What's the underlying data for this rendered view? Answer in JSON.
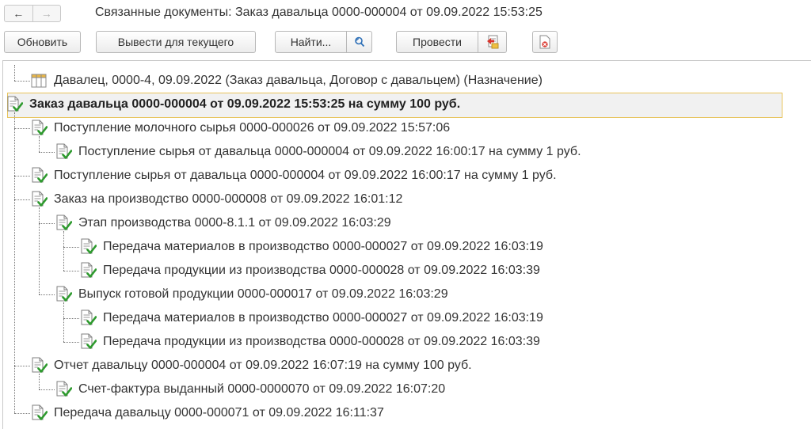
{
  "window": {
    "title": "Связанные документы: Заказ давальца 0000-000004 от 09.09.2022 15:53:25",
    "back_glyph": "←",
    "forward_glyph": "→"
  },
  "toolbar": {
    "refresh": "Обновить",
    "output_current": "Вывести для текущего",
    "find": "Найти...",
    "post": "Провести",
    "icons": {
      "find_refresh": "search-refresh-icon",
      "post_document": "post-document-icon",
      "delete_mark": "delete-mark-icon"
    }
  },
  "tree": {
    "rows": [
      {
        "label": "Давалец, 0000-4, 09.09.2022 (Заказ давальца, Договор с давальцем) (Назначение)",
        "level": 1,
        "icon": "register-table-icon"
      },
      {
        "label": "Заказ давальца 0000-000004 от 09.09.2022 15:53:25 на сумму 100 руб.",
        "level": 0,
        "icon": "posted-document-icon",
        "selected": true
      },
      {
        "label": "Поступление молочного сырья 0000-000026 от 09.09.2022 15:57:06",
        "level": 1,
        "icon": "posted-document-icon"
      },
      {
        "label": "Поступление сырья от давальца 0000-000004 от 09.09.2022 16:00:17 на сумму 1 руб.",
        "level": 2,
        "icon": "posted-document-icon"
      },
      {
        "label": "Поступление сырья от давальца 0000-000004 от 09.09.2022 16:00:17 на сумму 1 руб.",
        "level": 1,
        "icon": "posted-document-icon"
      },
      {
        "label": "Заказ на производство 0000-000008 от 09.09.2022 16:01:12",
        "level": 1,
        "icon": "posted-document-icon"
      },
      {
        "label": "Этап производства 0000-8.1.1 от 09.09.2022 16:03:29",
        "level": 2,
        "icon": "posted-document-icon"
      },
      {
        "label": "Передача материалов в производство 0000-000027 от 09.09.2022 16:03:19",
        "level": 3,
        "icon": "posted-document-icon"
      },
      {
        "label": "Передача продукции из производства 0000-000028 от 09.09.2022 16:03:39",
        "level": 3,
        "icon": "posted-document-icon"
      },
      {
        "label": "Выпуск готовой продукции 0000-000017 от 09.09.2022 16:03:29",
        "level": 2,
        "icon": "posted-document-icon"
      },
      {
        "label": "Передача материалов в производство 0000-000027 от 09.09.2022 16:03:19",
        "level": 3,
        "icon": "posted-document-icon"
      },
      {
        "label": "Передача продукции из производства 0000-000028 от 09.09.2022 16:03:39",
        "level": 3,
        "icon": "posted-document-icon"
      },
      {
        "label": "Отчет давальцу 0000-000004 от 09.09.2022 16:07:19 на сумму 100 руб.",
        "level": 1,
        "icon": "posted-document-icon"
      },
      {
        "label": "Счет-фактура выданный 0000-0000070 от 09.09.2022 16:07:20",
        "level": 2,
        "icon": "posted-document-icon"
      },
      {
        "label": "Передача давальцу 0000-000071 от 09.09.2022 16:11:37",
        "level": 1,
        "icon": "posted-document-icon"
      }
    ]
  },
  "colors": {
    "selection_border": "#e8c45b",
    "selection_fill": "#f1f1f1",
    "check_green": "#2e9a2e"
  }
}
